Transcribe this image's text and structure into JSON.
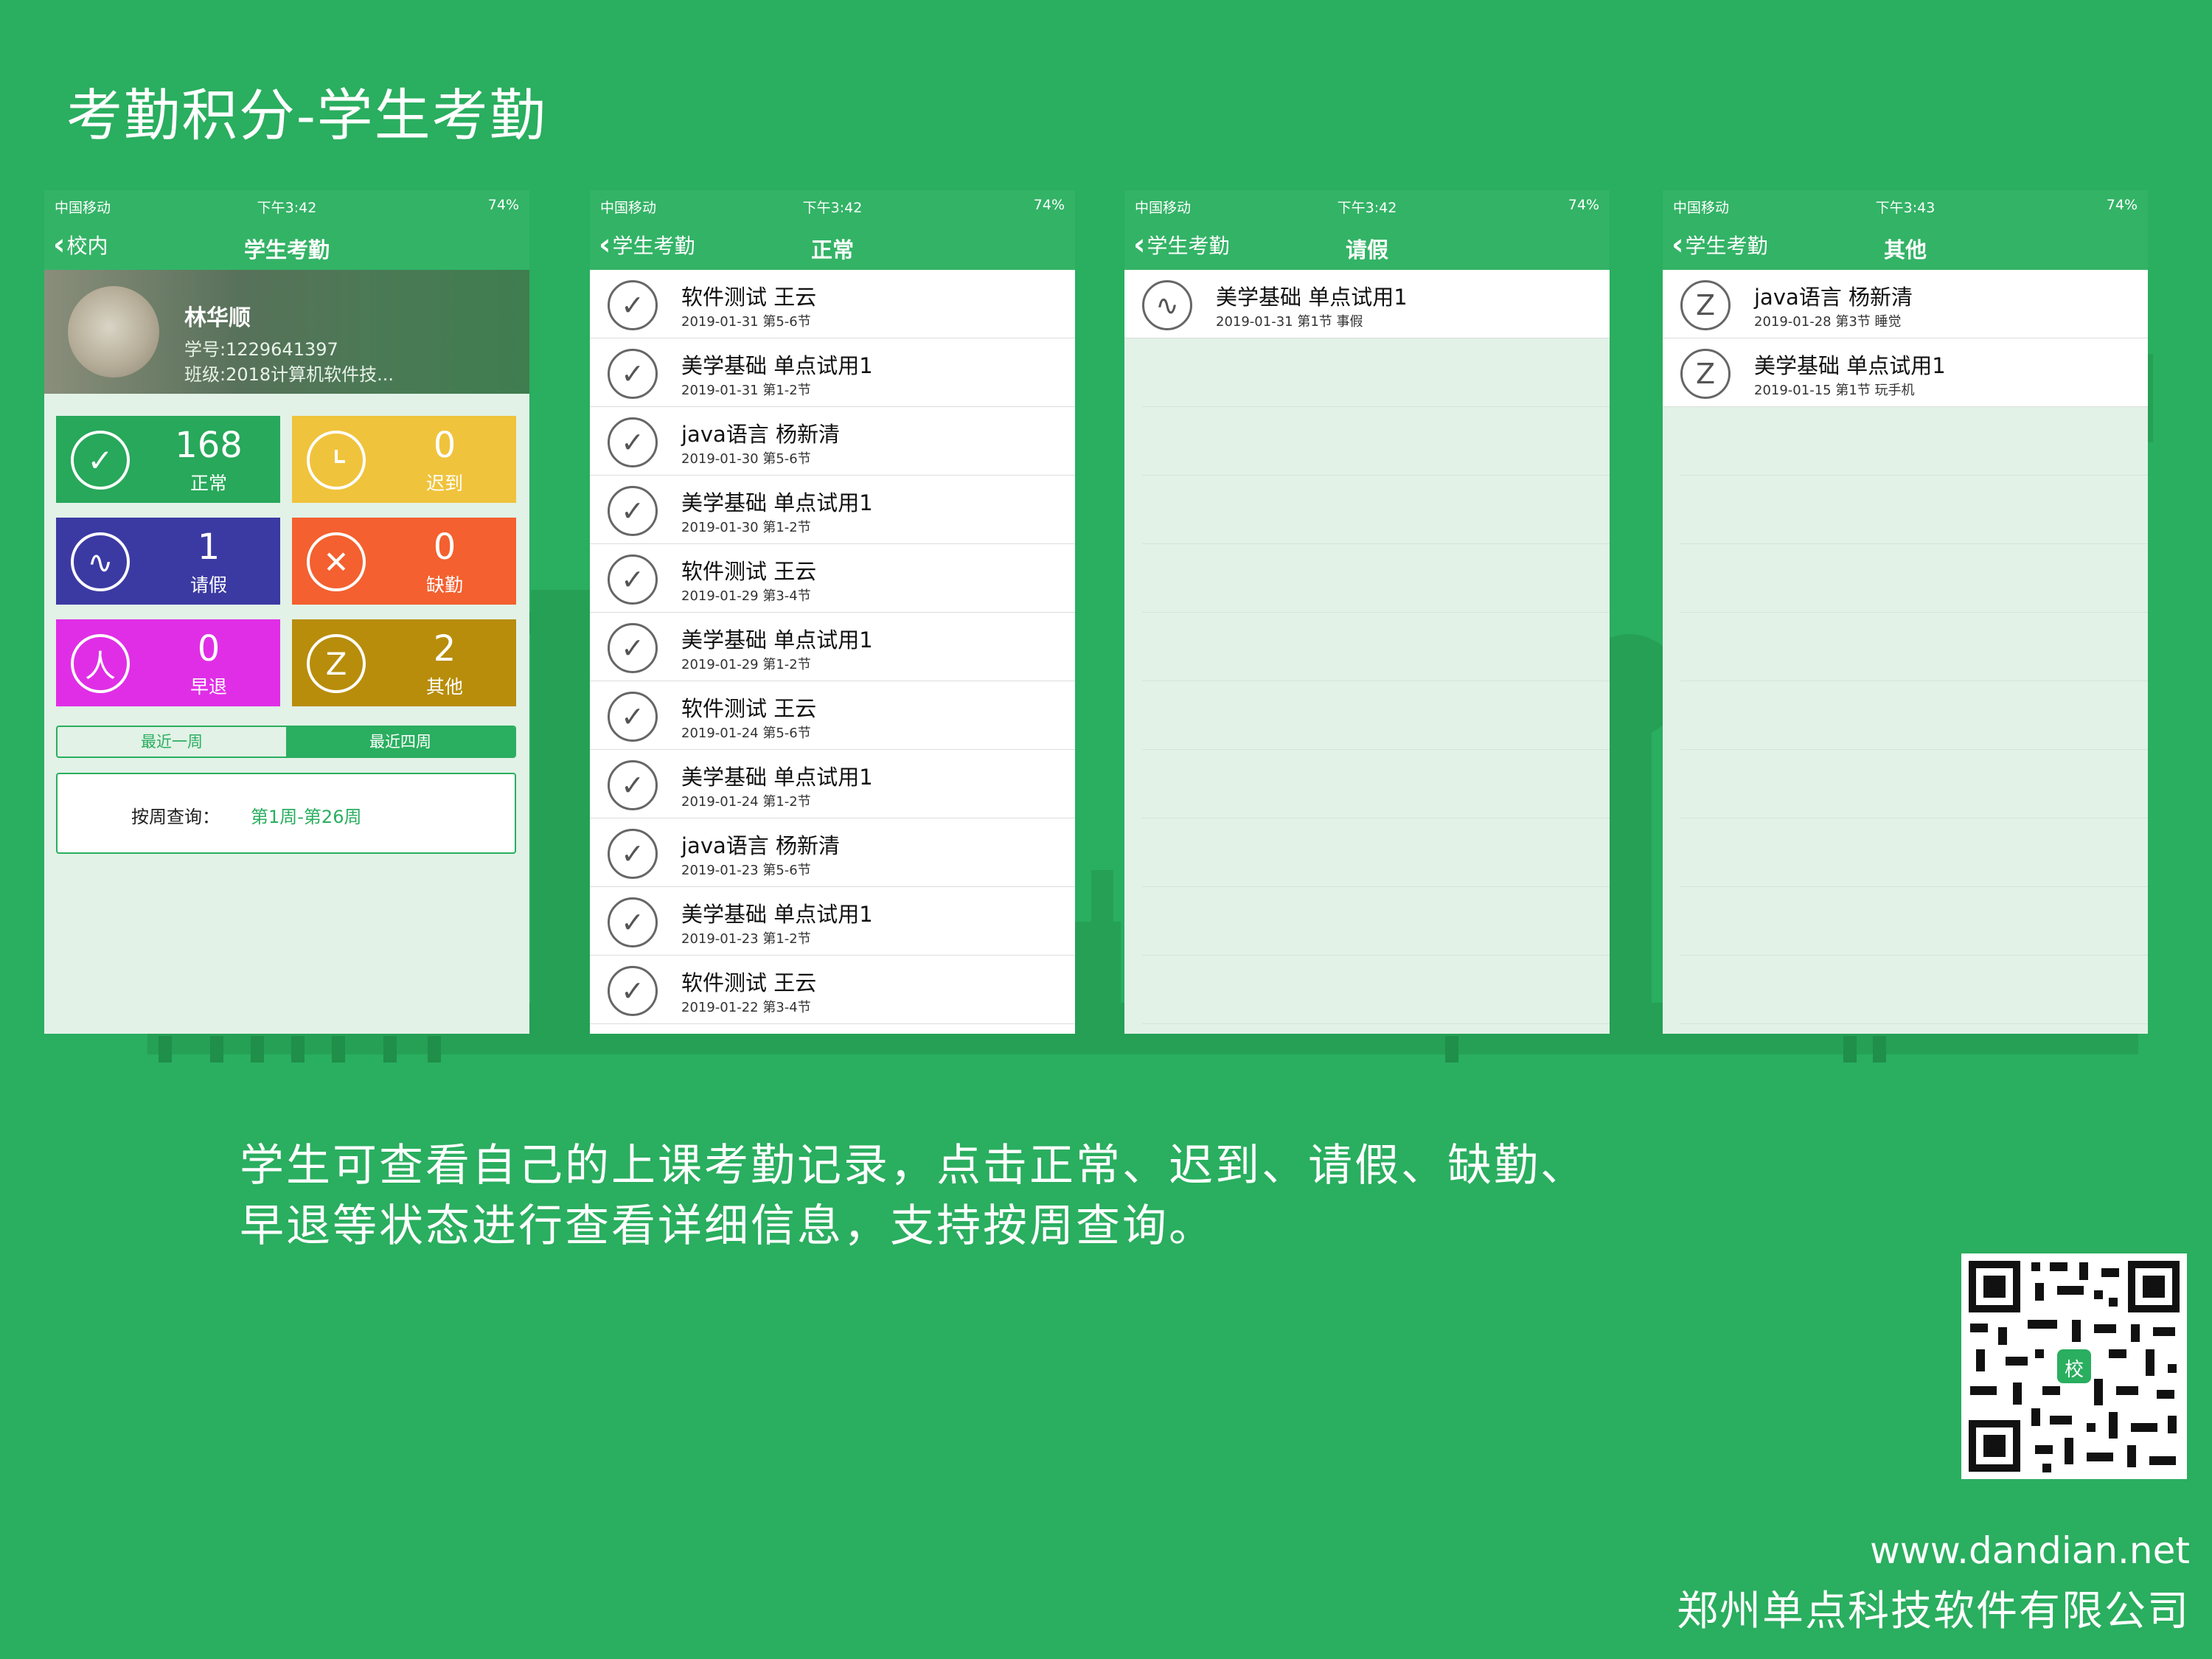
{
  "slide": {
    "title": "考勤积分-学生考勤",
    "description_line1": "学生可查看自己的上课考勤记录，点击正常、迟到、请假、缺勤、",
    "description_line2": "早退等状态进行查看详细信息，支持按周查询。",
    "website": "www.dandian.net",
    "company": "郑州单点科技软件有限公司",
    "qr_badge": "校"
  },
  "status": {
    "carrier": "中国移动",
    "battery": "74%",
    "time_a": "下午3:42",
    "time_b": "下午3:43"
  },
  "phone1": {
    "back": "校内",
    "title": "学生考勤",
    "name": "林华顺",
    "student_id": "学号:1229641397",
    "class": "班级:2018计算机软件技...",
    "tiles": [
      {
        "num": "168",
        "label": "正常",
        "color": "#27a85a",
        "icon": "check-icon"
      },
      {
        "num": "0",
        "label": "迟到",
        "color": "#f0c33c",
        "icon": "clock-icon"
      },
      {
        "num": "1",
        "label": "请假",
        "color": "#3b3aa3",
        "icon": "wave-icon"
      },
      {
        "num": "0",
        "label": "缺勤",
        "color": "#f4602f",
        "icon": "x-icon"
      },
      {
        "num": "0",
        "label": "早退",
        "color": "#e02ee6",
        "icon": "person-icon"
      },
      {
        "num": "2",
        "label": "其他",
        "color": "#b88d0b",
        "icon": "z-icon"
      }
    ],
    "seg_recent_week": "最近一周",
    "seg_recent_4weeks": "最近四周",
    "query_label": "按周查询：",
    "query_value": "第1周-第26周"
  },
  "phone2": {
    "back": "学生考勤",
    "title": "正常",
    "rows": [
      {
        "title": "软件测试 王云",
        "sub": "2019-01-31 第5-6节"
      },
      {
        "title": "美学基础 单点试用1",
        "sub": "2019-01-31 第1-2节"
      },
      {
        "title": "java语言 杨新清",
        "sub": "2019-01-30 第5-6节"
      },
      {
        "title": "美学基础 单点试用1",
        "sub": "2019-01-30 第1-2节"
      },
      {
        "title": "软件测试 王云",
        "sub": "2019-01-29 第3-4节"
      },
      {
        "title": "美学基础 单点试用1",
        "sub": "2019-01-29 第1-2节"
      },
      {
        "title": "软件测试 王云",
        "sub": "2019-01-24 第5-6节"
      },
      {
        "title": "美学基础 单点试用1",
        "sub": "2019-01-24 第1-2节"
      },
      {
        "title": "java语言 杨新清",
        "sub": "2019-01-23 第5-6节"
      },
      {
        "title": "美学基础 单点试用1",
        "sub": "2019-01-23 第1-2节"
      },
      {
        "title": "软件测试 王云",
        "sub": "2019-01-22 第3-4节"
      }
    ]
  },
  "phone3": {
    "back": "学生考勤",
    "title": "请假",
    "rows": [
      {
        "title": "美学基础 单点试用1",
        "sub": "2019-01-31 第1节 事假"
      }
    ]
  },
  "phone4": {
    "back": "学生考勤",
    "title": "其他",
    "rows": [
      {
        "title": "java语言 杨新清",
        "sub": "2019-01-28 第3节 睡觉"
      },
      {
        "title": "美学基础 单点试用1",
        "sub": "2019-01-15 第1节 玩手机"
      }
    ]
  }
}
